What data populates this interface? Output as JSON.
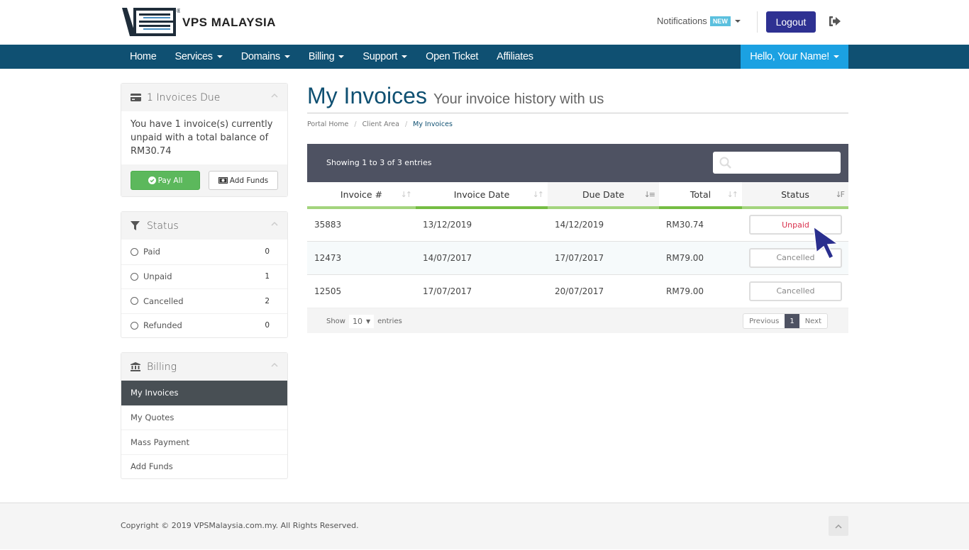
{
  "brand": {
    "name": "VPS MALAYSIA",
    "registered_mark": "®"
  },
  "header": {
    "notifications_label": "Notifications",
    "notifications_badge": "NEW",
    "logout_label": "Logout"
  },
  "nav": {
    "items": [
      {
        "label": "Home",
        "dropdown": false
      },
      {
        "label": "Services",
        "dropdown": true
      },
      {
        "label": "Domains",
        "dropdown": true
      },
      {
        "label": "Billing",
        "dropdown": true
      },
      {
        "label": "Support",
        "dropdown": true
      },
      {
        "label": "Open Ticket",
        "dropdown": false
      },
      {
        "label": "Affiliates",
        "dropdown": false
      }
    ],
    "user_label": "Hello, Your Name!"
  },
  "sidebar": {
    "invoices_due": {
      "title": "1 Invoices Due",
      "message": "You have 1 invoice(s) currently unpaid with a total balance of RM30.74",
      "pay_all_label": "Pay All",
      "add_funds_label": "Add Funds"
    },
    "status": {
      "title": "Status",
      "items": [
        {
          "label": "Paid",
          "count": "0"
        },
        {
          "label": "Unpaid",
          "count": "1"
        },
        {
          "label": "Cancelled",
          "count": "2"
        },
        {
          "label": "Refunded",
          "count": "0"
        }
      ]
    },
    "billing": {
      "title": "Billing",
      "items": [
        {
          "label": "My Invoices",
          "active": true
        },
        {
          "label": "My Quotes",
          "active": false
        },
        {
          "label": "Mass Payment",
          "active": false
        },
        {
          "label": "Add Funds",
          "active": false
        }
      ]
    }
  },
  "main": {
    "title": "My Invoices",
    "subtitle": "Your invoice history with us",
    "breadcrumb": [
      "Portal Home",
      "Client Area",
      "My Invoices"
    ],
    "table_info": "Showing 1 to 3 of 3 entries",
    "search_placeholder": "",
    "columns": [
      "Invoice #",
      "Invoice Date",
      "Due Date",
      "Total",
      "Status"
    ],
    "rows": [
      {
        "invoice": "35883",
        "invoice_date": "13/12/2019",
        "due_date": "14/12/2019",
        "total": "RM30.74",
        "status": "Unpaid"
      },
      {
        "invoice": "12473",
        "invoice_date": "14/07/2017",
        "due_date": "17/07/2017",
        "total": "RM79.00",
        "status": "Cancelled"
      },
      {
        "invoice": "12505",
        "invoice_date": "17/07/2017",
        "due_date": "20/07/2017",
        "total": "RM79.00",
        "status": "Cancelled"
      }
    ],
    "footer": {
      "show_label": "Show",
      "page_size": "10",
      "entries_label": "entries",
      "previous_label": "Previous",
      "current_page": "1",
      "next_label": "Next"
    }
  },
  "footer": {
    "copyright": "Copyright © 2019 VPSMalaysia.com.my. All Rights Reserved."
  },
  "colors": {
    "nav_bg": "#0f5072",
    "user_menu_bg": "#1ba1e2",
    "logout_bg": "#2e3192",
    "pay_button": "#5cb85c",
    "unpaid_text": "#d9304c",
    "table_header_bg": "#4e5262",
    "column_underline": "#a3d47d"
  }
}
